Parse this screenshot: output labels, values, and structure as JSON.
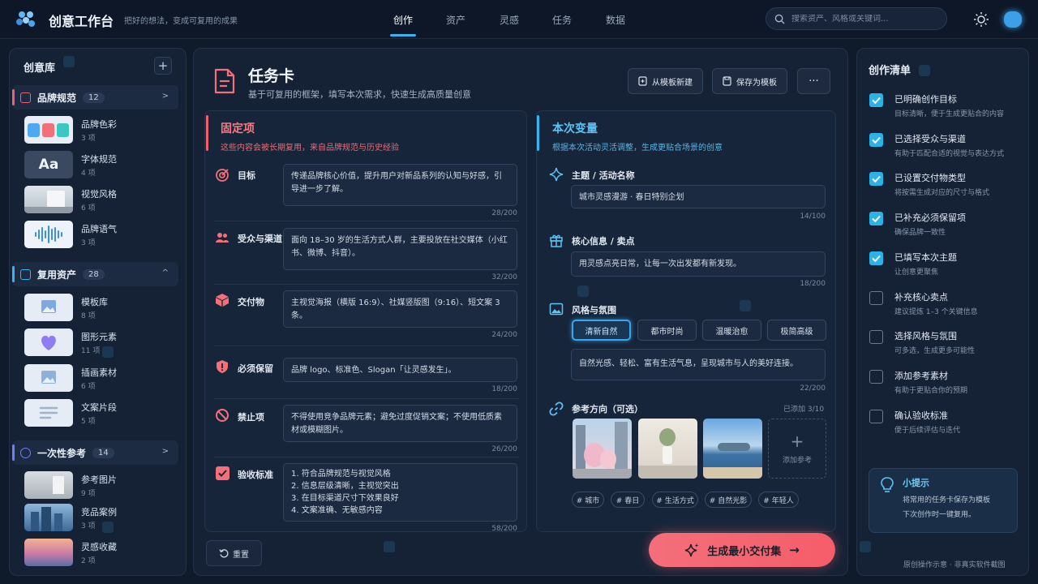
{
  "topbar": {
    "app_title": "创意工作台",
    "app_subtitle": "把好的想法，变成可复用的成果",
    "nav": [
      "创作",
      "资产",
      "灵感",
      "任务",
      "数据"
    ],
    "active_nav": "创作",
    "search_placeholder": "搜索资产、风格或关键词...",
    "icons": [
      "logo-icon",
      "search-icon",
      "sun-icon",
      "theme-toggle"
    ]
  },
  "library": {
    "title": "创意库",
    "groups": [
      {
        "label": "品牌规范",
        "count": "12",
        "color": "#f0606e",
        "items": [
          {
            "name": "品牌色彩",
            "count": "3 项"
          },
          {
            "name": "字体规范",
            "count": "4 项",
            "thumb_text": "Aa"
          },
          {
            "name": "视觉风格",
            "count": "6 项"
          },
          {
            "name": "品牌语气",
            "count": "3 项"
          }
        ]
      },
      {
        "label": "复用资产",
        "count": "28",
        "color": "#37b4f2",
        "items": [
          {
            "name": "模板库",
            "count": "8 项"
          },
          {
            "name": "图形元素",
            "count": "11 项"
          },
          {
            "name": "插画素材",
            "count": "6 项"
          },
          {
            "name": "文案片段",
            "count": "5 项"
          }
        ]
      },
      {
        "label": "一次性参考",
        "count": "14",
        "color": "#6f7dff",
        "items": [
          {
            "name": "参考图片",
            "count": "9 项"
          },
          {
            "name": "竞品案例",
            "count": "3 项"
          },
          {
            "name": "灵感收藏",
            "count": "2 项"
          }
        ]
      }
    ]
  },
  "task": {
    "title": "任务卡",
    "subtitle": "基于可复用的框架，填写本次需求，快速生成高质量创意",
    "btn_template_new": "从模板新建",
    "btn_save_template": "保存为模板",
    "btn_more": "···"
  },
  "fixed": {
    "title": "固定项",
    "subtitle": "这些内容会被长期复用，来自品牌规范与历史经验",
    "rows": [
      {
        "label": "目标",
        "text": "传递品牌核心价值，提升用户对新品系列的认知与好感，引导进一步了解。",
        "counter": "28/200"
      },
      {
        "label": "受众与渠道",
        "text": "面向 18–30 岁的生活方式人群，主要投放在社交媒体（小红书、微博、抖音）。",
        "counter": "32/200"
      },
      {
        "label": "交付物",
        "text": "主视觉海报（横版 16:9）、社媒竖版图（9:16）、短文案 3 条。",
        "counter": "24/200"
      },
      {
        "label": "必须保留",
        "text": "品牌 logo、标准色、Slogan「让灵感发生」。",
        "counter": "18/200"
      },
      {
        "label": "禁止项",
        "text": "不得使用竞争品牌元素；避免过度促销文案；不使用低质素材或模糊图片。",
        "counter": "26/200"
      },
      {
        "label": "验收标准",
        "list": [
          "1.  符合品牌规范与视觉风格",
          "2.  信息层级清晰，主视觉突出",
          "3.  在目标渠道尺寸下效果良好",
          "4.  文案准确、无敏感内容"
        ],
        "counter": "58/200"
      }
    ]
  },
  "vary": {
    "title": "本次变量",
    "subtitle": "根据本次活动灵活调整，生成更贴合场景的创意",
    "theme_label": "主题 / 活动名称",
    "theme_value": "城市灵感漫游 · 春日特别企划",
    "theme_counter": "14/100",
    "core_label": "核心信息 / 卖点",
    "core_value": "用灵感点亮日常，让每一次出发都有新发现。",
    "core_counter": "18/200",
    "style_label": "风格与氛围",
    "style_options": [
      "清新自然",
      "都市时尚",
      "温暖治愈",
      "极简高级"
    ],
    "style_selected": "清新自然",
    "style_desc": "自然光感、轻松、富有生活气息，呈现城市与人的美好连接。",
    "style_counter": "22/200",
    "ref_label": "参考方向（可选）",
    "ref_count": "已添加 3/10",
    "ref_add": "添加参考",
    "tags": [
      "# 城市",
      "# 春日",
      "# 生活方式",
      "# 自然光影",
      "# 年轻人"
    ]
  },
  "actions": {
    "reset": "重置",
    "generate": "生成最小交付集"
  },
  "checklist": {
    "title": "创作清单",
    "items": [
      {
        "title": "已明确创作目标",
        "desc": "目标清晰，便于生成更贴合的内容",
        "checked": true
      },
      {
        "title": "已选择受众与渠道",
        "desc": "有助于匹配合适的视觉与表达方式",
        "checked": true
      },
      {
        "title": "已设置交付物类型",
        "desc": "将按需生成对应的尺寸与格式",
        "checked": true
      },
      {
        "title": "已补充必须保留项",
        "desc": "确保品牌一致性",
        "checked": true
      },
      {
        "title": "已填写本次主题",
        "desc": "让创意更聚焦",
        "checked": true
      },
      {
        "title": "补充核心卖点",
        "desc": "建议提炼 1–3 个关键信息",
        "checked": false
      },
      {
        "title": "选择风格与氛围",
        "desc": "可多选，生成更多可能性",
        "checked": false
      },
      {
        "title": "添加参考素材",
        "desc": "有助于更贴合你的预期",
        "checked": false
      },
      {
        "title": "确认验收标准",
        "desc": "便于后续评估与迭代",
        "checked": false
      }
    ],
    "tip_title": "小提示",
    "tip_lines": [
      "将常用的任务卡保存为模板",
      "下次创作时一键复用。"
    ]
  },
  "footnote": "原创操作示意 · 非真实软件截图",
  "colors": {
    "accent_blue": "#37b4f2",
    "accent_red": "#f0606e",
    "generate": "#f36f7a"
  }
}
